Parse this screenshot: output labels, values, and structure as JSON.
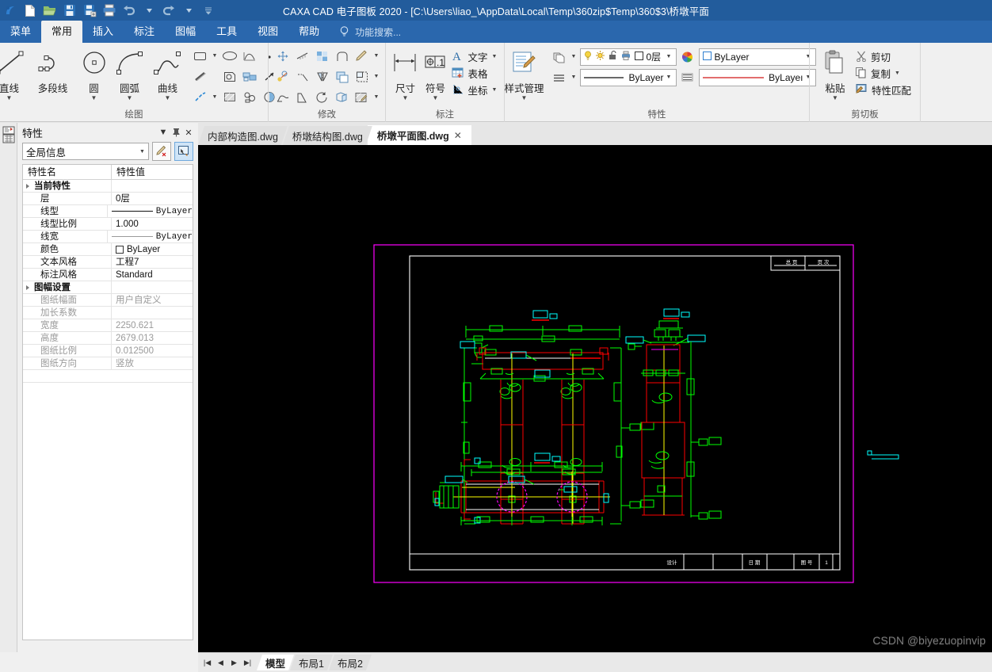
{
  "window": {
    "title": "CAXA CAD 电子图板 2020 - [C:\\Users\\liao_\\AppData\\Local\\Temp\\360zip$Temp\\360$3\\桥墩平面",
    "quick_access": [
      "new-icon",
      "open-icon",
      "save-icon",
      "save-as-icon",
      "print-icon",
      "undo-icon",
      "redo-icon",
      "more-icon"
    ]
  },
  "ribbon": {
    "tabs": [
      {
        "label": "菜单",
        "active": false
      },
      {
        "label": "常用",
        "active": true
      },
      {
        "label": "插入",
        "active": false
      },
      {
        "label": "标注",
        "active": false
      },
      {
        "label": "图幅",
        "active": false
      },
      {
        "label": "工具",
        "active": false
      },
      {
        "label": "视图",
        "active": false
      },
      {
        "label": "帮助",
        "active": false
      }
    ],
    "search_placeholder": "功能搜索...",
    "groups": {
      "draw": {
        "label": "绘图",
        "big": [
          {
            "label": "直线",
            "icon": "line-icon"
          },
          {
            "label": "多段线",
            "icon": "polyline-icon"
          },
          {
            "label": "圆",
            "icon": "circle-icon"
          },
          {
            "label": "圆弧",
            "icon": "arc-icon"
          },
          {
            "label": "曲线",
            "icon": "spline-icon"
          }
        ],
        "small": [
          "rectangle-icon",
          "ellipse-icon",
          "parabola-icon",
          "point-icon",
          "hatch-line-icon",
          "local-detail-icon",
          "view-break-icon",
          "arrow-icon",
          "center-line-icon",
          "hatch-fill-icon",
          "block-icon",
          "pie-icon"
        ]
      },
      "modify": {
        "label": "修改",
        "small": [
          "move-icon",
          "trim-icon",
          "array-icon",
          "fillet-icon",
          "chamfer-pencil-icon",
          "copy-move-icon",
          "extend-icon",
          "mirror-icon",
          "offset-icon",
          "scale-icon",
          "stretch-icon",
          "break-icon",
          "rotate-icon",
          "explode-icon",
          "edit-hatch-icon"
        ]
      },
      "annotate": {
        "label": "标注",
        "big": [
          {
            "label": "尺寸",
            "icon": "dimension-icon"
          },
          {
            "label": "符号",
            "icon": "symbol-icon"
          }
        ],
        "items": [
          {
            "label": "文字",
            "icon": "text-icon"
          },
          {
            "label": "表格",
            "icon": "table-icon"
          },
          {
            "label": "坐标",
            "icon": "coordinate-icon"
          }
        ]
      },
      "properties": {
        "label": "特性",
        "style_manager": {
          "label": "样式管理",
          "icon": "style-manager-icon"
        },
        "layer_value": "0层",
        "color_value": "ByLayer",
        "linetype_value": "ByLayer",
        "lineweight_value": "ByLayeı"
      },
      "clipboard": {
        "label": "剪切板",
        "paste": {
          "label": "粘贴",
          "icon": "paste-icon"
        },
        "items": [
          {
            "label": "剪切",
            "icon": "cut-icon"
          },
          {
            "label": "复制",
            "icon": "copy-icon"
          },
          {
            "label": "特性匹配",
            "icon": "match-properties-icon"
          }
        ]
      }
    }
  },
  "properties_panel": {
    "title": "特性",
    "header_icons": [
      "chevron-down-icon",
      "pin-icon",
      "close-icon"
    ],
    "selector_value": "全局信息",
    "tool_icons": [
      "edit-style-icon",
      "pick-properties-icon"
    ],
    "columns": [
      "特性名",
      "特性值"
    ],
    "rows": [
      {
        "type": "group",
        "key": "当前特性",
        "value": ""
      },
      {
        "type": "item",
        "key": "层",
        "value": "0层"
      },
      {
        "type": "linetype",
        "key": "线型",
        "value": "ByLayer"
      },
      {
        "type": "mono",
        "key": "线型比例",
        "value": "1.000"
      },
      {
        "type": "lineweight",
        "key": "线宽",
        "value": "ByLayer"
      },
      {
        "type": "color",
        "key": "颜色",
        "value": "ByLayer"
      },
      {
        "type": "mono",
        "key": "文本风格",
        "value": "工程7"
      },
      {
        "type": "mono",
        "key": "标注风格",
        "value": "Standard"
      },
      {
        "type": "group",
        "key": "图幅设置",
        "value": ""
      },
      {
        "type": "dim",
        "key": "图纸幅面",
        "value": "用户自定义"
      },
      {
        "type": "dim",
        "key": "加长系数",
        "value": ""
      },
      {
        "type": "dim-mono",
        "key": "宽度",
        "value": "2250.621"
      },
      {
        "type": "dim-mono",
        "key": "高度",
        "value": "2679.013"
      },
      {
        "type": "dim-mono",
        "key": "图纸比例",
        "value": "0.012500"
      },
      {
        "type": "dim",
        "key": "图纸方向",
        "value": "竖放"
      }
    ]
  },
  "document_tabs": [
    {
      "label": "内部构造图.dwg",
      "active": false,
      "closable": false
    },
    {
      "label": "桥墩结构图.dwg",
      "active": false,
      "closable": false
    },
    {
      "label": "桥墩平面图.dwg",
      "active": true,
      "closable": true,
      "close_glyph": "✕"
    }
  ],
  "canvas": {
    "background_color": "#000000",
    "frame_color": "#ff00ff",
    "border_color": "#ffffff",
    "drawing_title_block_top": [
      "总 页",
      "页 次"
    ],
    "drawing_title_block_bottom": [
      "设计",
      "日期",
      "图号",
      "1"
    ],
    "entity_colors": {
      "construction_green": "#00ff00",
      "structure_red": "#ff0000",
      "centerline_yellow": "#ffff00",
      "label_cyan": "#00ffff",
      "pile_magenta": "#ff00ff",
      "white": "#ffffff"
    },
    "watermark": "CSDN @biyezuopinvip"
  },
  "status_bar": {
    "nav_buttons": [
      "first-icon",
      "prev-icon",
      "next-icon",
      "last-icon"
    ],
    "layout_tabs": [
      {
        "label": "模型",
        "active": true
      },
      {
        "label": "布局1",
        "active": false
      },
      {
        "label": "布局2",
        "active": false
      }
    ]
  }
}
